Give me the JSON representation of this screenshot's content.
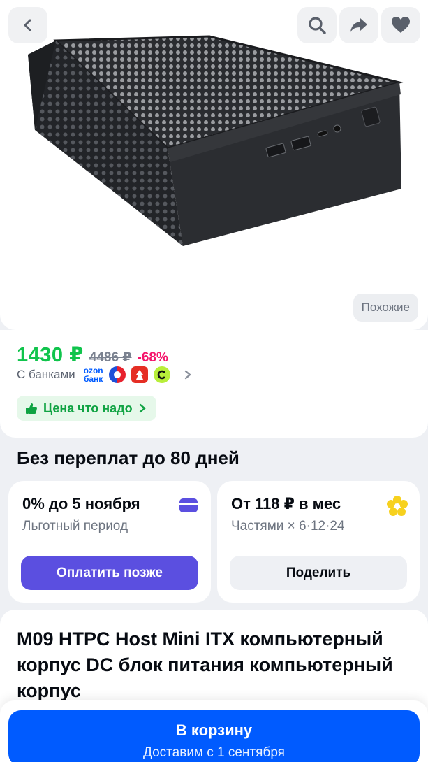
{
  "header": {
    "back_icon": "chevron-left-icon",
    "search_icon": "search-icon",
    "share_icon": "share-icon",
    "favorite_icon": "heart-icon",
    "similar_label": "Похожие"
  },
  "price": {
    "current": "1430 ₽",
    "old": "4486 ₽",
    "discount": "-68%",
    "banks_label": "С банками",
    "ozon_line1": "ozon",
    "ozon_line2": "банк",
    "good_price_label": "Цена что надо"
  },
  "installments": {
    "section_title": "Без переплат до 80 дней",
    "card_left": {
      "title": "0% до 5 ноября",
      "subtitle": "Льготный период",
      "button": "Оплатить позже"
    },
    "card_right": {
      "title": "От 118 ₽ в мес",
      "subtitle": "Частями × 6·12·24",
      "button": "Поделить"
    }
  },
  "product": {
    "title": "M09 HTPC Host Mini ITX компьютерный корпус DC блок питания компьютерный корпус"
  },
  "cart": {
    "button_label": "В корзину",
    "delivery_label": "Доставим с 1 сентября"
  },
  "colors": {
    "accent_blue": "#005bff",
    "price_green": "#10c44c",
    "discount_pink": "#f5156b",
    "pay_later_purple": "#5b4fe0"
  }
}
